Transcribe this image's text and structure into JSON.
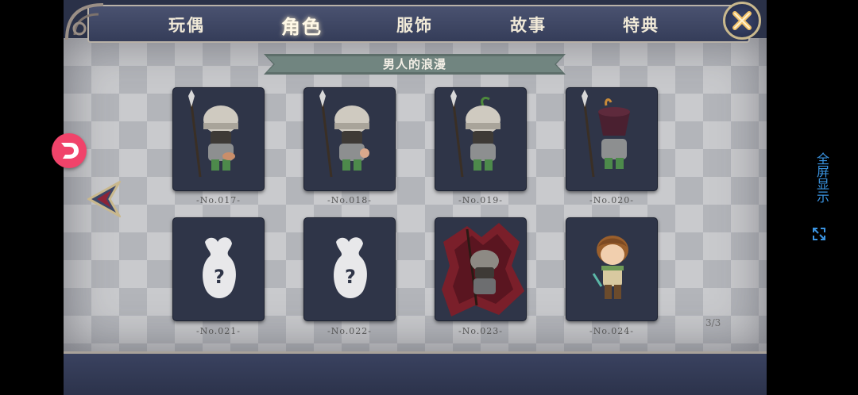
{
  "tabs": [
    {
      "label": "玩偶",
      "active": false
    },
    {
      "label": "角色",
      "active": true
    },
    {
      "label": "服饰",
      "active": false
    },
    {
      "label": "故事",
      "active": false
    },
    {
      "label": "特典",
      "active": false
    }
  ],
  "section_title": "男人的浪漫",
  "cards": [
    {
      "label": "-No.017-",
      "state": "unlocked",
      "figure": "helmet-soldier"
    },
    {
      "label": "-No.018-",
      "state": "unlocked",
      "figure": "helmet-soldier"
    },
    {
      "label": "-No.019-",
      "state": "unlocked",
      "figure": "helmet-soldier-sprout"
    },
    {
      "label": "-No.020-",
      "state": "unlocked",
      "figure": "pot-helmet-soldier"
    },
    {
      "label": "-No.021-",
      "state": "locked",
      "figure": "unknown-silhouette"
    },
    {
      "label": "-No.022-",
      "state": "locked",
      "figure": "unknown-silhouette"
    },
    {
      "label": "-No.023-",
      "state": "unlocked",
      "figure": "cursed-soldier"
    },
    {
      "label": "-No.024-",
      "state": "unlocked",
      "figure": "brown-hair-boy"
    }
  ],
  "page_indicator": "3/3",
  "overlay": {
    "fullscreen_label": "全屏显示",
    "app_logo": "app-logo-icon"
  },
  "colors": {
    "accent": "#f0436a",
    "fullscreen": "#3a93e0",
    "card_bg": "#2f3548"
  }
}
